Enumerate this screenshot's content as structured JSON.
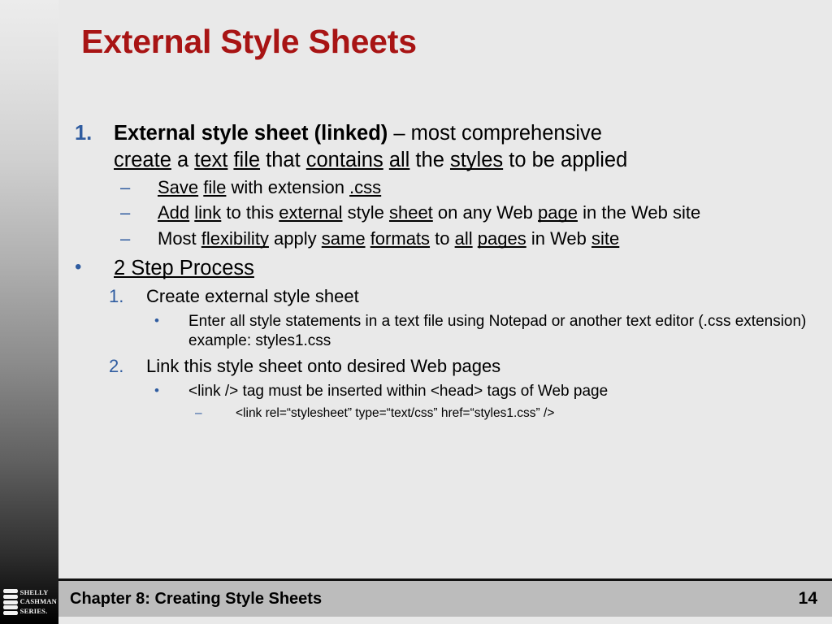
{
  "slide": {
    "title": "External Style Sheets",
    "background_color": "#e9e9e9",
    "title_color": "#a81414",
    "accent_color": "#2f5ca0"
  },
  "bullets": {
    "b1": {
      "marker": "1.",
      "lead": "External style sheet (linked)",
      "rest": " –  most comprehensive ",
      "line2_parts": [
        "create",
        " a ",
        "text",
        " ",
        "file",
        " that ",
        "contains",
        " ",
        "all",
        " the ",
        "styles",
        " to be applied"
      ]
    },
    "b1_sub1": {
      "marker": "–",
      "parts": [
        "Save",
        " ",
        "file",
        " with extension ",
        ".css"
      ]
    },
    "b1_sub2": {
      "marker": "–",
      "parts": [
        "Add",
        " ",
        "link",
        " to this ",
        "external",
        " style ",
        "sheet",
        " on any Web ",
        "page",
        " in the Web site"
      ]
    },
    "b1_sub3": {
      "marker": "–",
      "parts": [
        "Most ",
        "flexibility",
        " apply ",
        "same",
        " ",
        "formats",
        " to ",
        "all",
        " ",
        "pages",
        " in Web ",
        "site"
      ]
    },
    "b2": {
      "marker": "•",
      "text": "2 Step Process"
    },
    "b2_step1": {
      "marker": "1.",
      "text": "Create external style sheet"
    },
    "b2_step1_sub": {
      "marker": "•",
      "text": "Enter all style statements in a text file using Notepad or another text editor (.css extension) example: styles1.css"
    },
    "b2_step2": {
      "marker": "2.",
      "text": "Link this style sheet onto desired Web pages"
    },
    "b2_step2_sub": {
      "marker": "•",
      "text": "<link /> tag must be inserted within <head> tags of Web page"
    },
    "b2_step2_code": {
      "marker": "–",
      "text": "<link rel=“stylesheet” type=“text/css” href=“styles1.css” />"
    }
  },
  "footer": {
    "chapter": "Chapter 8: Creating Style Sheets",
    "page_number": "14",
    "logo_line1": "SHELLY",
    "logo_line2": "CASHMAN",
    "logo_line3": "SERIES."
  }
}
